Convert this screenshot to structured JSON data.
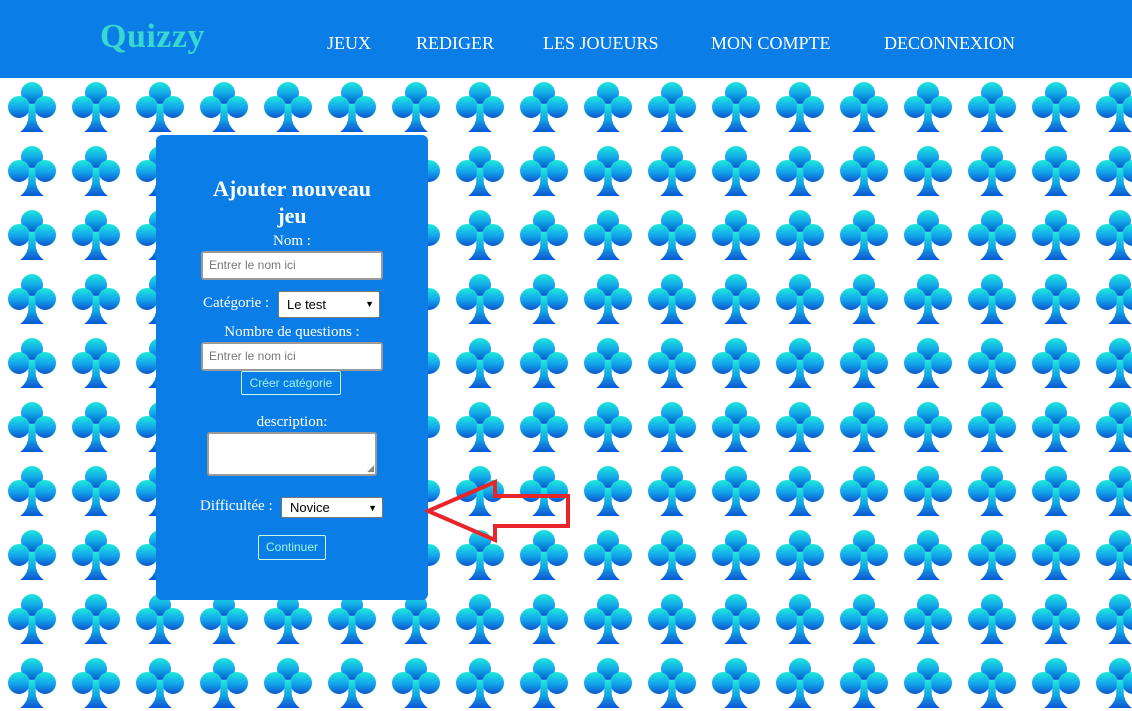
{
  "brand": "Quizzy",
  "nav": [
    "JEUX",
    "REDIGER",
    "LES JOUEURS",
    "MON COMPTE",
    "DECONNEXION"
  ],
  "form": {
    "title_line1": "Ajouter nouveau",
    "title_line2": "jeu",
    "name_label": "Nom :",
    "name_placeholder": "Entrer le nom ici",
    "category_label": "Catégorie :",
    "category_value": "Le test",
    "questions_label": "Nombre de questions :",
    "questions_placeholder": "Entrer le nom ici",
    "create_category_label": "Créer catégorie",
    "description_label": "description:",
    "difficulty_label": "Difficultée :",
    "difficulty_value": "Novice",
    "continue_label": "Continuer"
  },
  "colors": {
    "header_bg": "#0a7ee6",
    "brand": "#3ad6d0",
    "card_bg": "#0a7ee6",
    "annotation_arrow": "#e8252b"
  },
  "icons": {
    "background_pattern": "club-suit-icon",
    "annotation": "arrow-left-icon"
  }
}
